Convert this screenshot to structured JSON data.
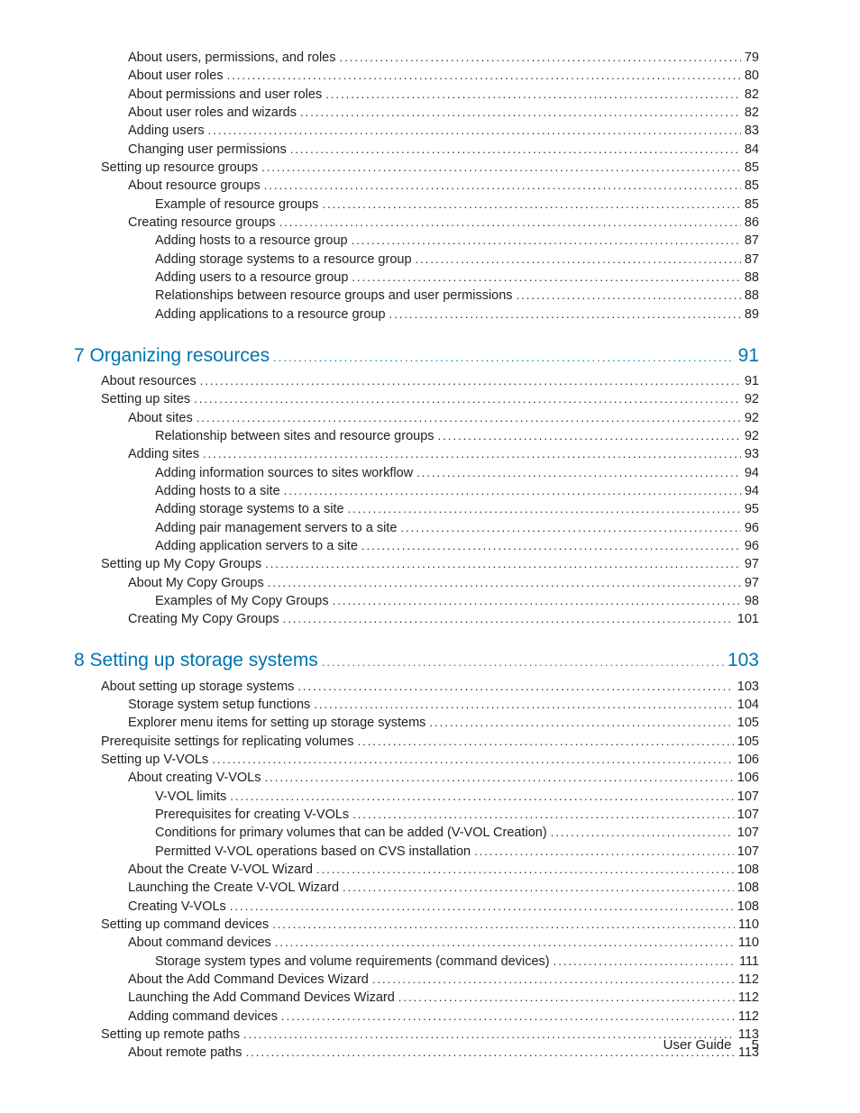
{
  "toc": [
    {
      "indent": 2,
      "title": "About users, permissions, and roles",
      "page": "79"
    },
    {
      "indent": 2,
      "title": "About user roles",
      "page": "80"
    },
    {
      "indent": 2,
      "title": "About permissions and user roles",
      "page": "82"
    },
    {
      "indent": 2,
      "title": "About user roles and wizards",
      "page": "82"
    },
    {
      "indent": 2,
      "title": "Adding users",
      "page": "83"
    },
    {
      "indent": 2,
      "title": "Changing user permissions",
      "page": "84"
    },
    {
      "indent": 1,
      "title": "Setting up resource groups",
      "page": "85"
    },
    {
      "indent": 2,
      "title": "About resource groups",
      "page": "85"
    },
    {
      "indent": 3,
      "title": "Example of resource groups",
      "page": "85"
    },
    {
      "indent": 2,
      "title": "Creating resource groups",
      "page": "86"
    },
    {
      "indent": 3,
      "title": "Adding hosts to a resource group",
      "page": "87"
    },
    {
      "indent": 3,
      "title": "Adding storage systems to a resource group",
      "page": "87"
    },
    {
      "indent": 3,
      "title": "Adding users to a resource group",
      "page": "88"
    },
    {
      "indent": 3,
      "title": "Relationships between resource groups and user permissions",
      "page": "88"
    },
    {
      "indent": 3,
      "title": "Adding applications to a resource group",
      "page": "89"
    },
    {
      "chapter": true,
      "title": "7 Organizing resources",
      "page": "91"
    },
    {
      "indent": 1,
      "title": "About resources",
      "page": "91"
    },
    {
      "indent": 1,
      "title": "Setting up sites",
      "page": "92"
    },
    {
      "indent": 2,
      "title": "About sites",
      "page": "92"
    },
    {
      "indent": 3,
      "title": "Relationship between sites and resource groups",
      "page": "92"
    },
    {
      "indent": 2,
      "title": "Adding sites",
      "page": "93"
    },
    {
      "indent": 3,
      "title": "Adding information sources to sites workflow",
      "page": "94"
    },
    {
      "indent": 3,
      "title": "Adding hosts to a site",
      "page": "94"
    },
    {
      "indent": 3,
      "title": "Adding storage systems to a site",
      "page": "95"
    },
    {
      "indent": 3,
      "title": "Adding pair management servers to a site",
      "page": "96"
    },
    {
      "indent": 3,
      "title": "Adding application servers to a site",
      "page": "96"
    },
    {
      "indent": 1,
      "title": "Setting up My Copy Groups",
      "page": "97"
    },
    {
      "indent": 2,
      "title": "About My Copy Groups",
      "page": "97"
    },
    {
      "indent": 3,
      "title": "Examples of My Copy Groups",
      "page": "98"
    },
    {
      "indent": 2,
      "title": "Creating My Copy Groups",
      "page": "101"
    },
    {
      "chapter": true,
      "title": "8 Setting up storage systems",
      "page": "103"
    },
    {
      "indent": 1,
      "title": "About setting up storage systems",
      "page": "103"
    },
    {
      "indent": 2,
      "title": "Storage system setup functions",
      "page": "104"
    },
    {
      "indent": 2,
      "title": "Explorer menu items for setting up storage systems",
      "page": "105"
    },
    {
      "indent": 1,
      "title": "Prerequisite settings for replicating volumes",
      "page": "105"
    },
    {
      "indent": 1,
      "title": "Setting up V-VOLs",
      "page": "106"
    },
    {
      "indent": 2,
      "title": "About creating V-VOLs",
      "page": "106"
    },
    {
      "indent": 3,
      "title": "V-VOL limits",
      "page": "107"
    },
    {
      "indent": 3,
      "title": "Prerequisites for creating V-VOLs",
      "page": "107"
    },
    {
      "indent": 3,
      "title": "Conditions for primary volumes that can be added (V-VOL Creation)",
      "page": "107"
    },
    {
      "indent": 3,
      "title": "Permitted V-VOL operations based on CVS installation",
      "page": "107"
    },
    {
      "indent": 2,
      "title": "About the Create V-VOL Wizard",
      "page": "108"
    },
    {
      "indent": 2,
      "title": "Launching the Create V-VOL Wizard",
      "page": "108"
    },
    {
      "indent": 2,
      "title": "Creating V-VOLs",
      "page": "108"
    },
    {
      "indent": 1,
      "title": "Setting up command devices",
      "page": "110"
    },
    {
      "indent": 2,
      "title": "About command devices",
      "page": "110"
    },
    {
      "indent": 3,
      "title": "Storage system types and volume requirements (command devices)",
      "page": "111"
    },
    {
      "indent": 2,
      "title": "About the Add Command Devices Wizard",
      "page": "112"
    },
    {
      "indent": 2,
      "title": "Launching the Add Command Devices Wizard",
      "page": "112"
    },
    {
      "indent": 2,
      "title": "Adding command devices",
      "page": "112"
    },
    {
      "indent": 1,
      "title": "Setting up remote paths",
      "page": "113"
    },
    {
      "indent": 2,
      "title": "About remote paths",
      "page": "113"
    }
  ],
  "footer": {
    "label": "User Guide",
    "page": "5"
  }
}
